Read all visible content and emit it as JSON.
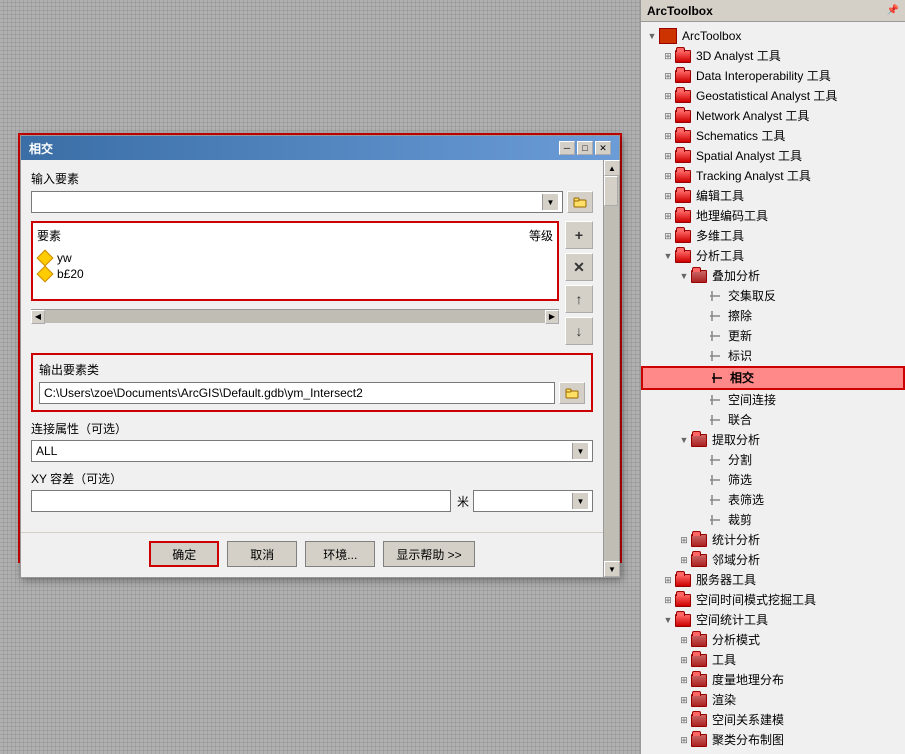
{
  "arctoolbox": {
    "title": "ArcToolbox",
    "pin_symbol": "📌",
    "root_item": "ArcToolbox",
    "items": [
      {
        "id": "3d-analyst",
        "label": "3D Analyst 工具",
        "level": 1,
        "expanded": false,
        "has_children": true
      },
      {
        "id": "data-interop",
        "label": "Data Interoperability 工具",
        "level": 1,
        "expanded": false,
        "has_children": true
      },
      {
        "id": "geostatistical",
        "label": "Geostatistical Analyst 工具",
        "level": 1,
        "expanded": false,
        "has_children": true
      },
      {
        "id": "network-analyst",
        "label": "Network Analyst 工具",
        "level": 1,
        "expanded": false,
        "has_children": true
      },
      {
        "id": "schematics",
        "label": "Schematics 工具",
        "level": 1,
        "expanded": false,
        "has_children": true
      },
      {
        "id": "spatial-analyst",
        "label": "Spatial Analyst 工具",
        "level": 1,
        "expanded": false,
        "has_children": true
      },
      {
        "id": "tracking-analyst",
        "label": "Tracking Analyst 工具",
        "level": 1,
        "expanded": false,
        "has_children": true
      },
      {
        "id": "edit-tools",
        "label": "编辑工具",
        "level": 1,
        "expanded": false,
        "has_children": true
      },
      {
        "id": "geocoding",
        "label": "地理编码工具",
        "level": 1,
        "expanded": false,
        "has_children": true
      },
      {
        "id": "multidim",
        "label": "多维工具",
        "level": 1,
        "expanded": false,
        "has_children": true
      },
      {
        "id": "analysis",
        "label": "分析工具",
        "level": 1,
        "expanded": true,
        "has_children": true
      },
      {
        "id": "overlay-analysis",
        "label": "叠加分析",
        "level": 2,
        "expanded": true,
        "has_children": true
      },
      {
        "id": "intersect-extract",
        "label": "交集取反",
        "level": 3,
        "is_tool": true
      },
      {
        "id": "erase",
        "label": "擦除",
        "level": 3,
        "is_tool": true
      },
      {
        "id": "update",
        "label": "更新",
        "level": 3,
        "is_tool": true
      },
      {
        "id": "identity",
        "label": "标识",
        "level": 3,
        "is_tool": true
      },
      {
        "id": "intersect",
        "label": "相交",
        "level": 3,
        "is_tool": true,
        "highlighted": true
      },
      {
        "id": "spatial-join",
        "label": "空间连接",
        "level": 3,
        "is_tool": true
      },
      {
        "id": "union",
        "label": "联合",
        "level": 3,
        "is_tool": true
      },
      {
        "id": "extract-analysis",
        "label": "提取分析",
        "level": 2,
        "expanded": true,
        "has_children": true
      },
      {
        "id": "split",
        "label": "分割",
        "level": 3,
        "is_tool": true
      },
      {
        "id": "select",
        "label": "筛选",
        "level": 3,
        "is_tool": true
      },
      {
        "id": "table-select",
        "label": "表筛选",
        "level": 3,
        "is_tool": true
      },
      {
        "id": "clip",
        "label": "裁剪",
        "level": 3,
        "is_tool": true
      },
      {
        "id": "stats-analysis",
        "label": "统计分析",
        "level": 2,
        "expanded": false,
        "has_children": true
      },
      {
        "id": "proximity",
        "label": "邻域分析",
        "level": 2,
        "expanded": false,
        "has_children": true
      },
      {
        "id": "server-tools",
        "label": "服务器工具",
        "level": 1,
        "expanded": false,
        "has_children": true
      },
      {
        "id": "spatiotemporal",
        "label": "空间时间模式挖掘工具",
        "level": 1,
        "expanded": false,
        "has_children": true
      },
      {
        "id": "spatial-stats",
        "label": "空间统计工具",
        "level": 1,
        "expanded": true,
        "has_children": true
      },
      {
        "id": "analysis-mode",
        "label": "分析模式",
        "level": 2,
        "expanded": false,
        "has_children": true
      },
      {
        "id": "tools",
        "label": "工具",
        "level": 2,
        "expanded": false,
        "has_children": true
      },
      {
        "id": "geodistribution",
        "label": "度量地理分布",
        "level": 2,
        "expanded": false,
        "has_children": true
      },
      {
        "id": "rendering",
        "label": "渲染",
        "level": 2,
        "expanded": false,
        "has_children": true
      },
      {
        "id": "spatial-relationship",
        "label": "空间关系建模",
        "level": 2,
        "expanded": false,
        "has_children": true
      },
      {
        "id": "cluster-map",
        "label": "聚类分布制图",
        "level": 2,
        "expanded": false,
        "has_children": true
      }
    ]
  },
  "dialog": {
    "title": "相交",
    "min_btn": "─",
    "max_btn": "□",
    "close_btn": "✕",
    "input_label": "输入要素",
    "input_placeholder": "",
    "feature_list_label": "要素",
    "feature_list_rank_label": "等级",
    "features": [
      {
        "name": "yw",
        "rank": ""
      },
      {
        "name": "b£20",
        "rank": ""
      }
    ],
    "output_label": "输出要素类",
    "output_value": "C:\\Users\\zoe\\Documents\\ArcGIS\\Default.gdb\\ym_Intersect2",
    "join_type_label": "连接属性（可选）",
    "join_type_value": "ALL",
    "xy_label": "XY 容差（可选）",
    "xy_value": "",
    "xy_unit": "米",
    "btn_ok": "确定",
    "btn_cancel": "取消",
    "btn_env": "环境...",
    "btn_help": "显示帮助 >>"
  }
}
